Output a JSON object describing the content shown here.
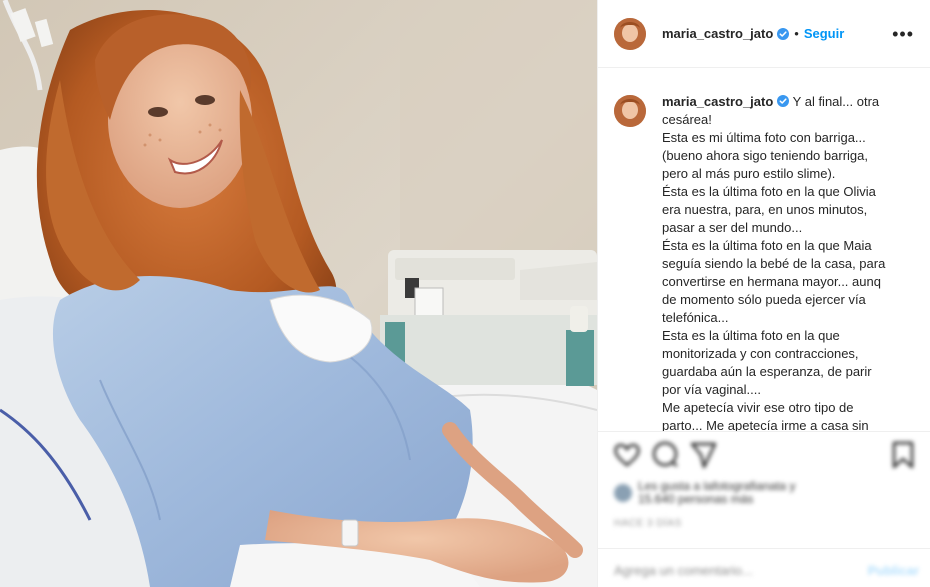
{
  "post": {
    "username": "maria_castro_jato",
    "follow_label": "Seguir",
    "more_label": "•••",
    "separator": "•"
  },
  "caption": {
    "username": "maria_castro_jato",
    "lines": [
      "Y al final... otra",
      "cesárea!",
      "Esta es mi última foto con barriga...",
      "(bueno ahora sigo teniendo barriga,",
      "pero al más puro estilo slime).",
      "Ésta es la última foto en la que Olivia",
      "era nuestra, para, en unos minutos,",
      "pasar a ser del mundo...",
      "Ésta es la última foto en la que Maia",
      "seguía siendo la bebé de la casa, para",
      "convertirse en hermana mayor... aunq",
      "de momento sólo pueda ejercer vía",
      "telefónica...",
      "Esta es la última foto en la que",
      "monitorizada y con contracciones,",
      "guardaba aún la esperanza, de parir",
      "por vía vaginal....",
      "Me apetecía vivir ese otro tipo de",
      "parto... Me apetecía irme a casa sin"
    ]
  },
  "likes": {
    "line1": "Les gusta a lafotografianata y",
    "line2": "15.640 personas más"
  },
  "date_label": "HACE 3 DÍAS",
  "comment": {
    "placeholder": "Agrega un comentario...",
    "post_label": "Publicar"
  },
  "icons": {
    "verified": "verified-badge-icon",
    "like": "heart-icon",
    "comment": "comment-bubble-icon",
    "share": "paper-plane-icon",
    "save": "bookmark-icon"
  },
  "colors": {
    "accent": "#0095f6",
    "verified": "#3897f0",
    "text": "#262626",
    "muted": "#8e8e8e"
  }
}
